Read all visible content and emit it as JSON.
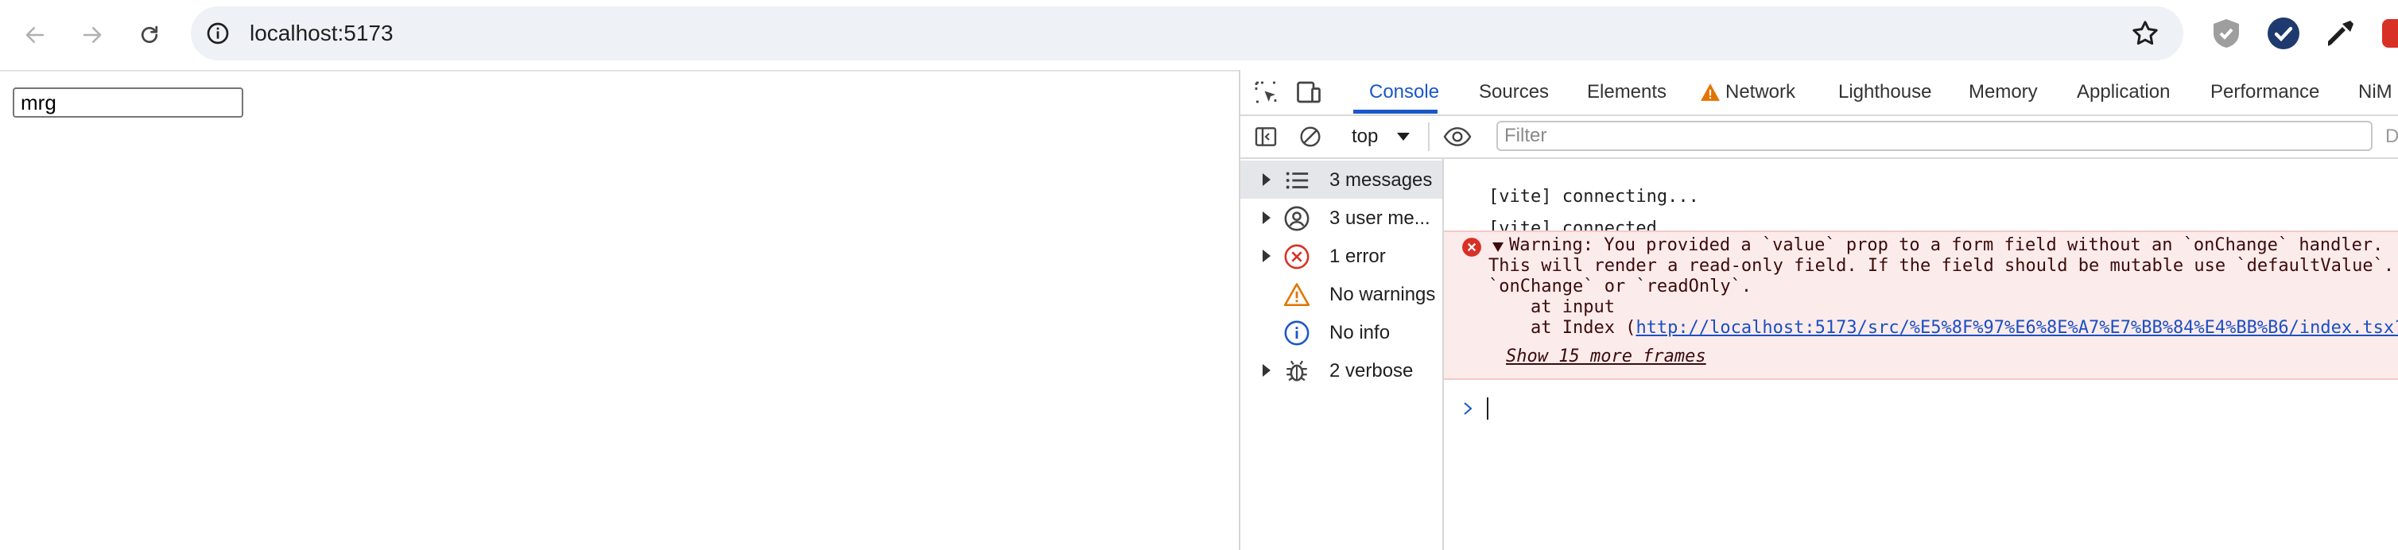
{
  "browser": {
    "url": "localhost:5173"
  },
  "page": {
    "input_value": "mrg"
  },
  "devtools": {
    "tabs": [
      "Console",
      "Sources",
      "Elements",
      "Network",
      "Lighthouse",
      "Memory",
      "Application",
      "Performance",
      "NiM"
    ],
    "active_tab": "Console",
    "context": "top",
    "filter_placeholder": "Filter",
    "filter_cut": "D",
    "sidebar": [
      {
        "label": "3 messages",
        "icon": "list-icon",
        "expandable": true,
        "selected": true
      },
      {
        "label": "3 user me...",
        "icon": "user-icon",
        "expandable": true,
        "selected": false
      },
      {
        "label": "1 error",
        "icon": "error-icon",
        "expandable": true,
        "selected": false
      },
      {
        "label": "No warnings",
        "icon": "warning-icon",
        "expandable": false,
        "selected": false
      },
      {
        "label": "No info",
        "icon": "info-icon",
        "expandable": false,
        "selected": false
      },
      {
        "label": "2 verbose",
        "icon": "bug-icon",
        "expandable": true,
        "selected": false
      }
    ],
    "console": {
      "messages": [
        "[vite] connecting...",
        "[vite] connected."
      ],
      "error": {
        "line1": "Warning: You provided a `value` prop to a form field without an `onChange` handler.",
        "line2": "This will render a read-only field. If the field should be mutable use `defaultValue`.",
        "line3": "`onChange` or `readOnly`.",
        "line4": "    at input",
        "line5_prefix": "    at Index (",
        "line5_link": "http://localhost:5173/src/%E5%8F%97%E6%8E%A7%E7%BB%84%E4%BB%B6/index.tsx?",
        "show_frames": "Show 15 more frames"
      }
    }
  },
  "colors": {
    "accent": "#1a57c9",
    "error_bg": "#fcebeb",
    "error_icon": "#d93025",
    "warning_icon": "#e37400"
  }
}
